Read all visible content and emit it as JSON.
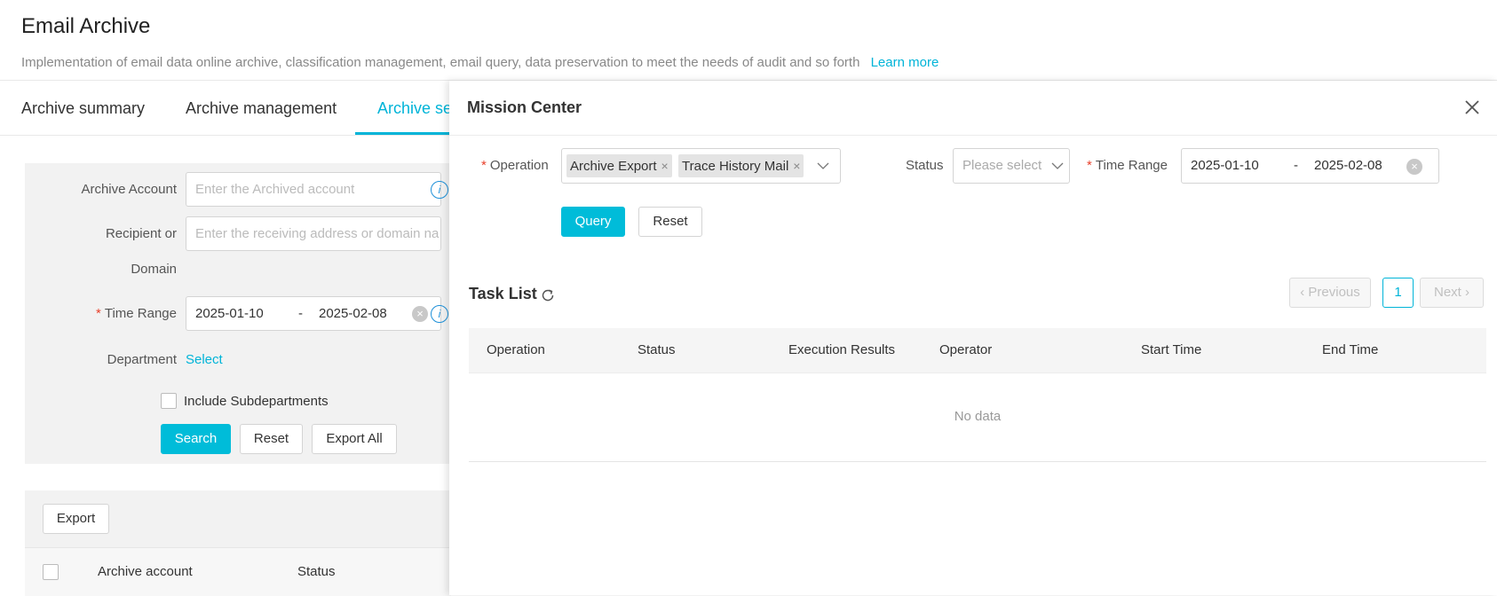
{
  "page": {
    "title": "Email Archive",
    "description": "Implementation of email data online archive, classification management, email query, data preservation to meet the needs of audit and so forth",
    "learn_more": "Learn more"
  },
  "tabs": [
    {
      "label": "Archive summary"
    },
    {
      "label": "Archive management"
    },
    {
      "label": "Archive se"
    }
  ],
  "filters": {
    "archive_account_label": "Archive Account",
    "archive_account_placeholder": "Enter the Archived account",
    "recipient_label_1": "Recipient or",
    "recipient_label_2": "Domain",
    "recipient_placeholder": "Enter the receiving address or domain na",
    "time_range_label": "Time Range",
    "required_mark": "*",
    "start_date": "2025-01-10",
    "date_sep": "-",
    "end_date": "2025-02-08",
    "department_label": "Department",
    "department_select": "Select",
    "include_sub_label": "Include Subdepartments",
    "search_label": "Search",
    "reset_label": "Reset",
    "export_all_label": "Export All"
  },
  "table": {
    "export_label": "Export",
    "columns": [
      "Archive account",
      "Status"
    ]
  },
  "drawer": {
    "title": "Mission Center",
    "operation_label": "Operation",
    "required_mark": "*",
    "operation_tags": [
      "Archive Export",
      "Trace History Mail"
    ],
    "tag_remove": "×",
    "status_label": "Status",
    "status_placeholder": "Please select",
    "time_range_label": "Time Range",
    "start_date": "2025-01-10",
    "date_sep": "-",
    "end_date": "2025-02-08",
    "query_label": "Query",
    "reset_label": "Reset",
    "task_list_title": "Task List",
    "pager": {
      "previous": "‹ Previous",
      "current": "1",
      "next": "Next ›"
    },
    "columns": [
      "Operation",
      "Status",
      "Execution Results",
      "Operator",
      "Start Time",
      "End Time"
    ],
    "no_data": "No data"
  },
  "colors": {
    "accent": "#00b4d8",
    "primary_button": "#00bcd9",
    "required": "#e8412c"
  }
}
